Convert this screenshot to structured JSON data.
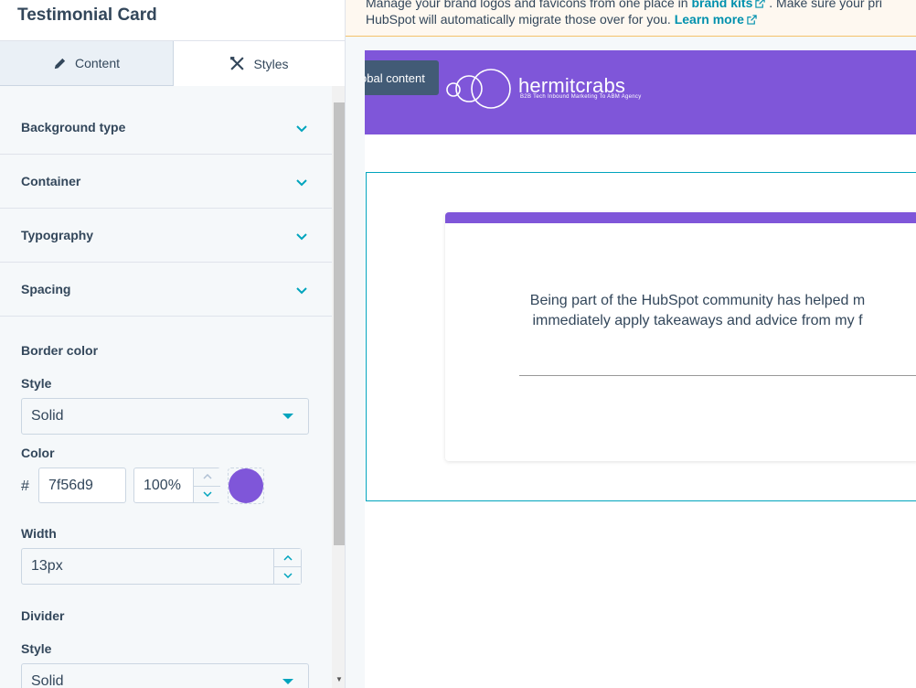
{
  "panel": {
    "title": "Testimonial Card",
    "tabs": [
      {
        "label": "Content",
        "active": false
      },
      {
        "label": "Styles",
        "active": true
      }
    ],
    "sections": [
      {
        "label": "Background type"
      },
      {
        "label": "Container"
      },
      {
        "label": "Typography"
      },
      {
        "label": "Spacing"
      }
    ],
    "border": {
      "heading": "Border color",
      "style_label": "Style",
      "style_value": "Solid",
      "color_label": "Color",
      "hash": "#",
      "color_hex": "7f56d9",
      "opacity": "100%",
      "swatch_color": "#7f56d9",
      "width_label": "Width",
      "width_value": "13px"
    },
    "divider": {
      "heading": "Divider",
      "style_label": "Style",
      "style_value": "Solid"
    }
  },
  "notice": {
    "line1_start": "Manage your brand logos and favicons from one place in ",
    "line1_link": "brand kits",
    "line1_end": ". Make sure your pri",
    "line2_start": "HubSpot will automatically migrate those over for you. ",
    "line2_link": "Learn more"
  },
  "preview": {
    "tooltip": "Global content",
    "logo_name": "hermitcrabs",
    "logo_tagline": "B2B Tech Inbound Marketing To ABM Agency",
    "quote_line1": "Being part of the HubSpot community has helped m",
    "quote_line2": "immediately apply takeaways and advice from my f",
    "header_color": "#7f56d9",
    "accent_color": "#00a4bd"
  }
}
